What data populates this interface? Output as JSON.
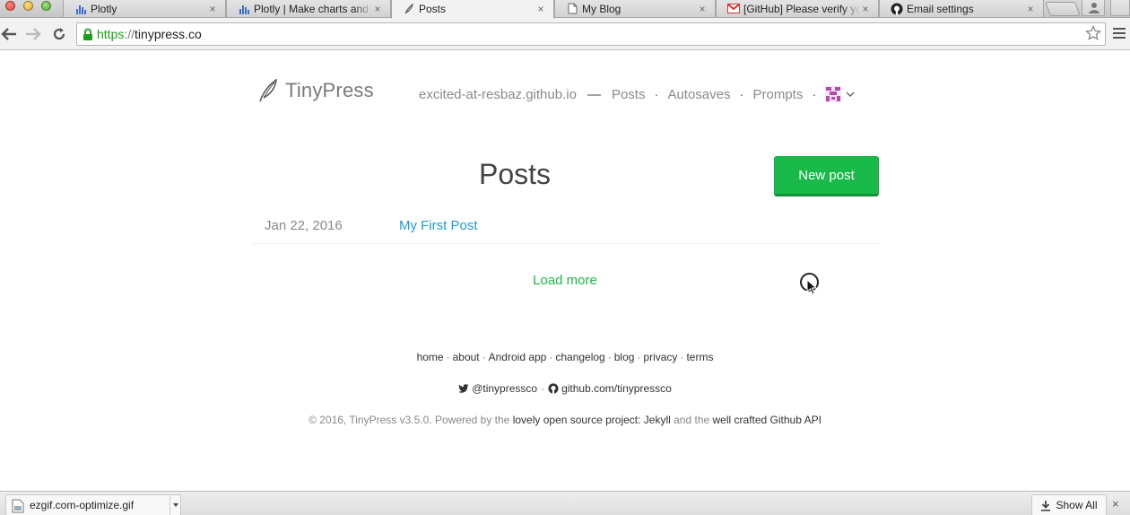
{
  "browser": {
    "tabs": [
      {
        "title": "Plotly",
        "icon": "plotly-icon",
        "active": false
      },
      {
        "title": "Plotly | Make charts and dashboards",
        "icon": "plotly-icon",
        "active": false
      },
      {
        "title": "Posts",
        "icon": "tinypress-feather-icon",
        "active": true
      },
      {
        "title": "My Blog",
        "icon": "document-icon",
        "active": false
      },
      {
        "title": "[GitHub] Please verify your email",
        "icon": "gmail-icon",
        "active": false
      },
      {
        "title": "Email settings",
        "icon": "github-icon",
        "active": false
      }
    ],
    "close_glyph": "×",
    "url_scheme": "https",
    "url_sep": "://",
    "url_host": "tinypress.co"
  },
  "header": {
    "logo_text": "TinyPress",
    "repo": "excited-at-resbaz.github.io",
    "dash": "—",
    "sep": "·",
    "nav": [
      "Posts",
      "Autosaves",
      "Prompts"
    ]
  },
  "main": {
    "heading": "Posts",
    "new_post_label": "New post",
    "posts": [
      {
        "date": "Jan 22, 2016",
        "title": "My First Post"
      }
    ],
    "load_more": "Load more"
  },
  "footer": {
    "links": [
      "home",
      "about",
      "Android app",
      "changelog",
      "blog",
      "privacy",
      "terms"
    ],
    "twitter": "@tinypressco",
    "github": "github.com/tinypressco",
    "copy_prefix": "© 2016, TinyPress v3.5.0. Powered by the ",
    "copy_link1": "lovely open source project: Jekyll",
    "copy_mid": " and the ",
    "copy_link2": "well crafted Github API"
  },
  "download_shelf": {
    "filename": "ezgif.com-optimize.gif",
    "show_all": "Show All",
    "close_glyph": "×"
  },
  "colors": {
    "accent_green": "#1aba4a",
    "link_blue": "#1e9bd7",
    "secure_green": "#1a9e1a"
  }
}
